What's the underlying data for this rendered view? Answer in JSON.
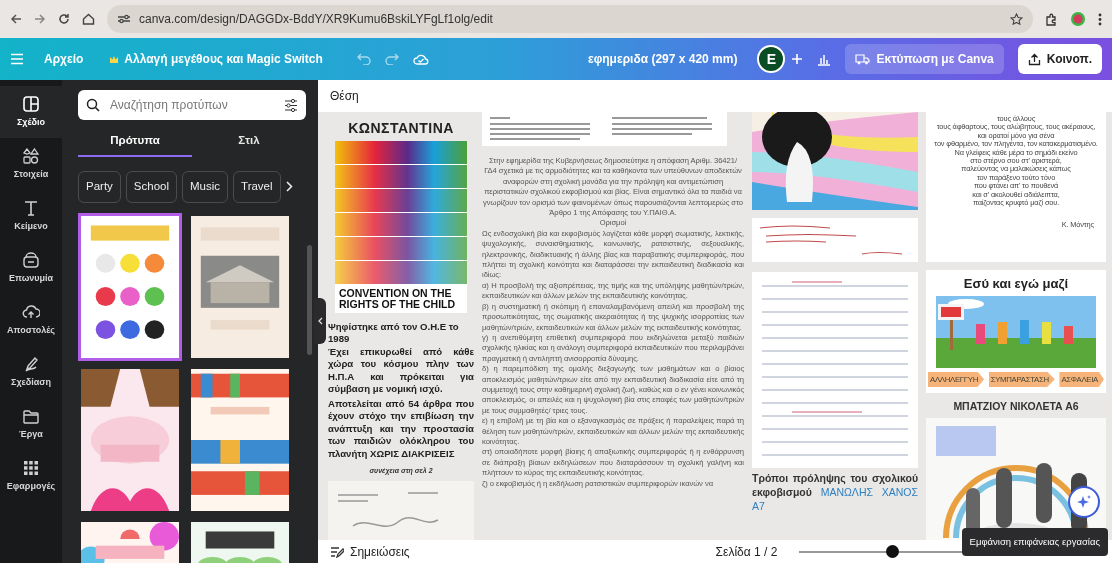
{
  "browser": {
    "url": "canva.com/design/DAGGDx-BddY/XR9Kumu6BskiLYFgLf1olg/edit"
  },
  "toolbar": {
    "file_menu": "Αρχείο",
    "resize_button": "Αλλαγή μεγέθους και Magic Switch",
    "design_title": "εφημεριδα (297 x 420 mm)",
    "avatar": "E",
    "print_button": "Εκτύπωση με Canva",
    "share_button": "Κοινοπ."
  },
  "sidebar": {
    "items": [
      {
        "label": "Σχέδιο",
        "selected": true
      },
      {
        "label": "Στοιχεία",
        "selected": false
      },
      {
        "label": "Κείμενο",
        "selected": false
      },
      {
        "label": "Επωνυμία",
        "selected": false
      },
      {
        "label": "Αποστολές",
        "selected": false
      },
      {
        "label": "Σχεδίαση",
        "selected": false
      },
      {
        "label": "Έργα",
        "selected": false
      },
      {
        "label": "Εφαρμογές",
        "selected": false
      }
    ]
  },
  "panel": {
    "search": {
      "placeholder": "Αναζήτηση προτύπων"
    },
    "tabs": [
      {
        "label": "Πρότυπα",
        "selected": true
      },
      {
        "label": "Στιλ",
        "selected": false
      }
    ],
    "chips": [
      "Party",
      "School",
      "Music",
      "Travel"
    ],
    "templates": [
      {
        "kind": "picture",
        "selected": true
      },
      {
        "kind": "picture",
        "selected": false
      },
      {
        "kind": "picture",
        "selected": false
      },
      {
        "kind": "picture",
        "selected": false
      },
      {
        "kind": "picture",
        "selected": false
      },
      {
        "kind": "picture",
        "selected": false
      }
    ]
  },
  "canvas": {
    "position_label": "Θέση",
    "newspaper": {
      "column_1": {
        "heading": "ΚΩΝΣΤΑΝΤΙΝΑ",
        "poster_caption": "CONVENTION ON THE RIGHTS OF THE CHILD",
        "paragraphs": [
          "Ψηφίστηκε από τον Ο.Η.Ε το 1989",
          "Έχει επικυρωθεί από κάθε χώρα του κόσμου πλην των Η.Π.Α και πρόκειται για σύμβαση με νομική ισχύ.",
          "Αποτελείται από 54 άρθρα που έχουν στόχο την επιβίωση την ανάπτυξη και την προστασία των παιδιών ολόκληρου του πλανήτη ΧΩΡΙΣ ΔΙΑΚΡΙΣΕΙΣ"
        ],
        "continue_note": "συνέχεια στη σελ 2"
      },
      "column_2": {
        "intro": "Στην εφημερίδα της Κυβερνήσεως δημοσιεύτηκε η απόφαση Αριθμ. 36421/ ΓΔ4 σχετικά με τις αρμοδιότητες και τα καθήκοντα των υπεύθυνων αποδεκτών αναφορών στη σχολική μονάδα για την πρόληψη και αντιμετώπιση περιστατικών σχολικού εκφοβισμού και βίας. Είναι σημαντικό όλα τα παιδιά να γνωρίζουν τον ορισμό των φαινομένων όπως παρουσιάζονται λεπτομερώς στο Άρθρο 1 της Απόφασης του Υ.ΠΑΙΘ.Α.",
        "subheading": "Ορισμοί",
        "paragraphs": [
          "Ως ενδοσχολική βία και εκφοβισμός λογίζεται κάθε μορφή σωματικής, λεκτικής, ψυχολογικής, συναισθηματικής, κοινωνικής, ρατσιστικής, σεξουαλικής, ηλεκτρονικής, διαδικτυακής ή άλλης βίας και παραβατικής συμπεριφοράς, που πλήττει τη σχολική κοινότητα και διαταράσσει την εκπαιδευτική διαδικασία και ιδίως:",
          "α) Η προσβολή της αξιοπρέπειας, της τιμής και της υπόληψης μαθητών/τριών, εκπαιδευτικών και άλλων μελών της εκπαιδευτικής κοινότητας.",
          "β) η συστηματική ή σκόπιμη ή επαναλαμβανόμενη απειλή και προσβολή της προσωπικότητας, της σωματικής ακεραιότητας ή της ψυχικής ισορροπίας των μαθητών/τριών, εκπαιδευτικών και άλλων μελών της εκπαιδευτικής κοινότητας.",
          "γ) η ανεπιθύμητη επιθετική συμπεριφορά που εκδηλώνεται μεταξύ παιδιών σχολικής ηλικίας και η ανάλογη συμπεριφορά εκπαιδευτικών που περιλαμβάνει πραγματική ή αντιληπτή ανισορροπία δύναμης.",
          "δ) η παρεμπόδιση της ομαλής διεξαγωγής των μαθημάτων και ο βίαιος αποκλεισμός μαθητών/τριων είτε από την εκπαιδευτική διαδικασία είτε από τη συμμετοχή τους στην καθημερινή σχολική ζωή, καθώς και ο εν γένει κοινωνικός αποκλεισμός, οι απειλές και η ψυχολογική βία στις επαφές των μαθητών/τριών με τους συμμαθητές/ τριες τους.",
          "ε) η επιβολή με τη βία και ο εξαναγκασμός σε πράξεις ή παραλείψεις παρά τη θέληση των μαθητών/τριών, εκπαιδευτικών και άλλων μελών της εκπαιδευτικής κοινότητας.",
          "στ) οποιαδήποτε μορφή βίαιης ή απαξιωτικής συμπεριφοράς ή η ενθάρρυνση σε διάπραξη βίαιων εκδηλώσεων που διαταράσσουν τη σχολική γαλήνη και πλήττουν το κύρος της εκπαιδευτικής κοινότητας.",
          "ζ) ο εκφοβισμός ή η εκδήλωση ρατσιστικών συμπεριφορών ικανών να"
        ]
      },
      "column_3": {
        "article_title": "Τρόποι πρόληψης του σχολικού εκφοβισμού",
        "article_author": "ΜΑΝΩΛΗΣ ΧΑΝΟΣ Α7"
      },
      "column_4": {
        "poem_lines": [
          "τους άλλους",
          "τους άφθαρτους, τους αλώβητους, τους ακέραιους,",
          "και ορατοί μόνο για σένα",
          "τον φθαρμένο, τον πληγέντα, τον κατακερματισμένο.",
          "Να γλείφεις κάθε μέρα το σημάδι εκείνο",
          "στο στέρνο σου στ' αριστερά,",
          "παλεύοντας να μαλακώσεις κάπως",
          "τον παράξενο τούτο τόνο",
          "που φτάνει απ' το πουθενά",
          "και σ' ακολουθεί αδιάλειπτα,",
          "παίζοντας κρυφτό μαζί σου."
        ],
        "poem_author": "Κ. Μόντης",
        "card_title": "Εσύ και εγώ μαζί",
        "tags": [
          "ΑΛΛΗΛΕΓΓΥΗ",
          "ΣΥΜΠΑΡΑΣΤΑΣΗ",
          "ΑΣΦΑΛΕΙΑ"
        ],
        "drawing_author": "ΜΠΑΤΖΙΟΥ ΝΙΚΟΛΕΤΑ Α6"
      }
    }
  },
  "footer": {
    "notes_button": "Σημειώσεις",
    "page_label": "Σελίδα 1 / 2",
    "zoom": {
      "level": 0.55
    },
    "tooltip": "Εμφάνιση επιφάνειας εργασίας"
  }
}
